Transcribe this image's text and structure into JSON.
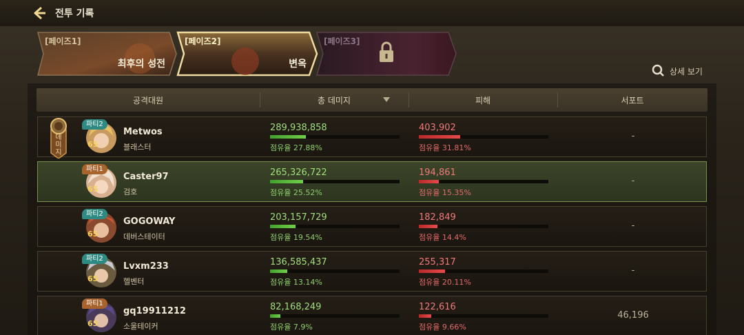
{
  "header": {
    "title": "전투 기록"
  },
  "phases": [
    {
      "num": "[페이즈1]",
      "name": "최후의 성전",
      "state": "normal"
    },
    {
      "num": "[페이즈2]",
      "name": "변옥",
      "state": "selected"
    },
    {
      "num": "[페이즈3]",
      "name": "",
      "state": "locked"
    }
  ],
  "detail_link": "상세 보기",
  "columns": {
    "attacker": "공격대원",
    "damage": "총 데미지",
    "taken": "피해",
    "support": "서포트"
  },
  "medal_text": "데미지",
  "rows": [
    {
      "party": "파티2",
      "level": "65",
      "name": "Metwos",
      "class": "블래스터",
      "damage": "289,938,858",
      "damage_share": "점유율 27.88%",
      "damage_pct": 27.88,
      "taken": "403,902",
      "taken_share": "점유율 31.81%",
      "taken_pct": 31.81,
      "support": "-"
    },
    {
      "party": "파티1",
      "level": "65",
      "name": "Caster97",
      "class": "검호",
      "damage": "265,326,722",
      "damage_share": "점유율 25.52%",
      "damage_pct": 25.52,
      "taken": "194,861",
      "taken_share": "점유율 15.35%",
      "taken_pct": 15.35,
      "support": "-"
    },
    {
      "party": "파티2",
      "level": "65",
      "name": "GOGOWAY",
      "class": "데버스테이터",
      "damage": "203,157,729",
      "damage_share": "점유율 19.54%",
      "damage_pct": 19.54,
      "taken": "182,849",
      "taken_share": "점유율 14.4%",
      "taken_pct": 14.4,
      "support": "-"
    },
    {
      "party": "파티2",
      "level": "65",
      "name": "Lvxm233",
      "class": "헬벤터",
      "damage": "136,585,437",
      "damage_share": "점유율 13.14%",
      "damage_pct": 13.14,
      "taken": "255,317",
      "taken_share": "점유율 20.11%",
      "taken_pct": 20.11,
      "support": "-"
    },
    {
      "party": "파티1",
      "level": "65",
      "name": "gq19911212",
      "class": "소울테이커",
      "damage": "82,168,249",
      "damage_share": "점유율 7.9%",
      "damage_pct": 7.9,
      "taken": "122,616",
      "taken_share": "점유율 9.66%",
      "taken_pct": 9.66,
      "support": "46,196"
    }
  ]
}
